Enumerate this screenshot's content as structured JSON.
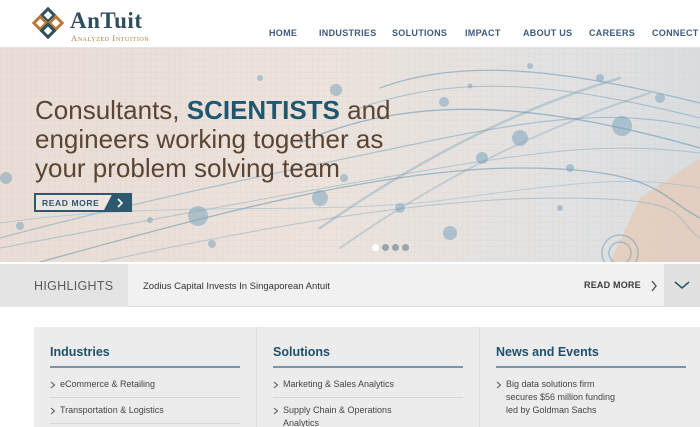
{
  "logo": {
    "name": "AnTuit",
    "tagline": "Analyzed Intuition"
  },
  "nav": {
    "items": [
      "HOME",
      "INDUSTRIES",
      "SOLUTIONS",
      "IMPACT",
      "ABOUT US",
      "CAREERS",
      "CONNECT"
    ]
  },
  "hero": {
    "line1_pre": "Consultants, ",
    "line1_accent": "SCIENTISTS",
    "line1_post": " and",
    "line2": "engineers working together as",
    "line3": "your problem solving team",
    "read_more": "READ MORE",
    "slide_count": 4,
    "active_slide": 1
  },
  "highlights": {
    "label": "HIGHLIGHTS",
    "text": "Zodius Capital Invests In Singaporean Antuit",
    "read_more": "READ MORE"
  },
  "columns": [
    {
      "title": "Industries",
      "items": [
        [
          "eCommerce & Retailing"
        ],
        [
          "Transportation & Logistics"
        ]
      ]
    },
    {
      "title": "Solutions",
      "items": [
        [
          "Marketing & Sales Analytics"
        ],
        [
          "Supply Chain & Operations",
          "Analytics"
        ]
      ]
    },
    {
      "title": "News and Events",
      "items": [
        [
          "Big data solutions firm",
          "secures $56 million funding",
          "led by Goldman Sachs"
        ]
      ]
    }
  ],
  "colors": {
    "brand_dark": "#2f4f5f",
    "brand_accent": "#b5793b",
    "nav_text": "#3d5a80",
    "headline_brown": "#5a4433",
    "headline_accent": "#1f5670"
  }
}
